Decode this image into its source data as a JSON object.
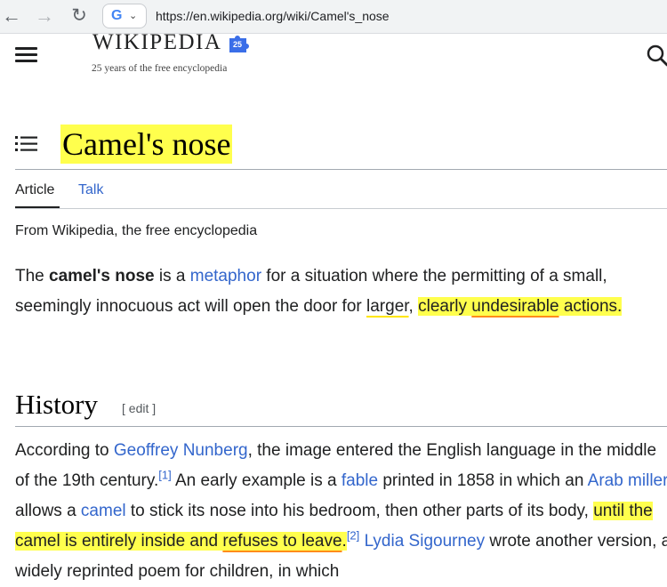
{
  "browser": {
    "url": "https://en.wikipedia.org/wiki/Camel's_nose",
    "site_chip_letter": "G",
    "icons": [
      "back-arrow-icon",
      "forward-arrow-icon",
      "reload-icon",
      "google-icon",
      "chevron-down-icon"
    ]
  },
  "header": {
    "logo_text": "WIKIPEDIA",
    "badge_text": "25",
    "tagline": "25 years of the free encyclopedia",
    "icons": [
      "hamburger-menu-icon",
      "search-icon"
    ]
  },
  "article": {
    "title": "Camel's nose",
    "tabs": [
      {
        "label": "Article",
        "selected": true
      },
      {
        "label": "Talk",
        "selected": false
      }
    ],
    "site_sub": "From Wikipedia, the free encyclopedia",
    "lead": {
      "t1": "The ",
      "bold": "camel's nose",
      "t2": " is a ",
      "link_metaphor": "metaphor",
      "t3": " for a situation where the permitting of a small, seemingly innocuous act will open the door for ",
      "larger": "larger",
      "comma": ", ",
      "hl_clearly": "clearly",
      "hl_space": " ",
      "hl_undesirable": "undesirable",
      "hl_actions": " actions."
    },
    "history": {
      "heading": "History",
      "edit_label": "[ edit ]",
      "t1": "According to ",
      "link_nunberg": "Geoffrey Nunberg",
      "t2": ", the image entered the English language in the middle of the 19th century.",
      "ref1": "[1]",
      "t3": " An early example is a ",
      "link_fable": "fable",
      "t4": " printed in 1858 in which an ",
      "link_arab_miller": "Arab miller",
      "t5": " allows a ",
      "link_camel": "camel",
      "t6": " to stick its nose into his bedroom, then other parts of its body, ",
      "hl_until": "until the camel is entirely inside and ",
      "hl_refuses": "refuses to leave",
      "period": ".",
      "ref2": "[2]",
      "link_sigourney": "Lydia Sigourney",
      "t7": " wrote another version, a widely reprinted poem for children, in which"
    }
  },
  "colors": {
    "link": "#3366cc",
    "highlight": "#ffff4d",
    "underline_yellow": "#ffe600",
    "underline_orange": "#ff8c1a",
    "text": "#202122"
  }
}
